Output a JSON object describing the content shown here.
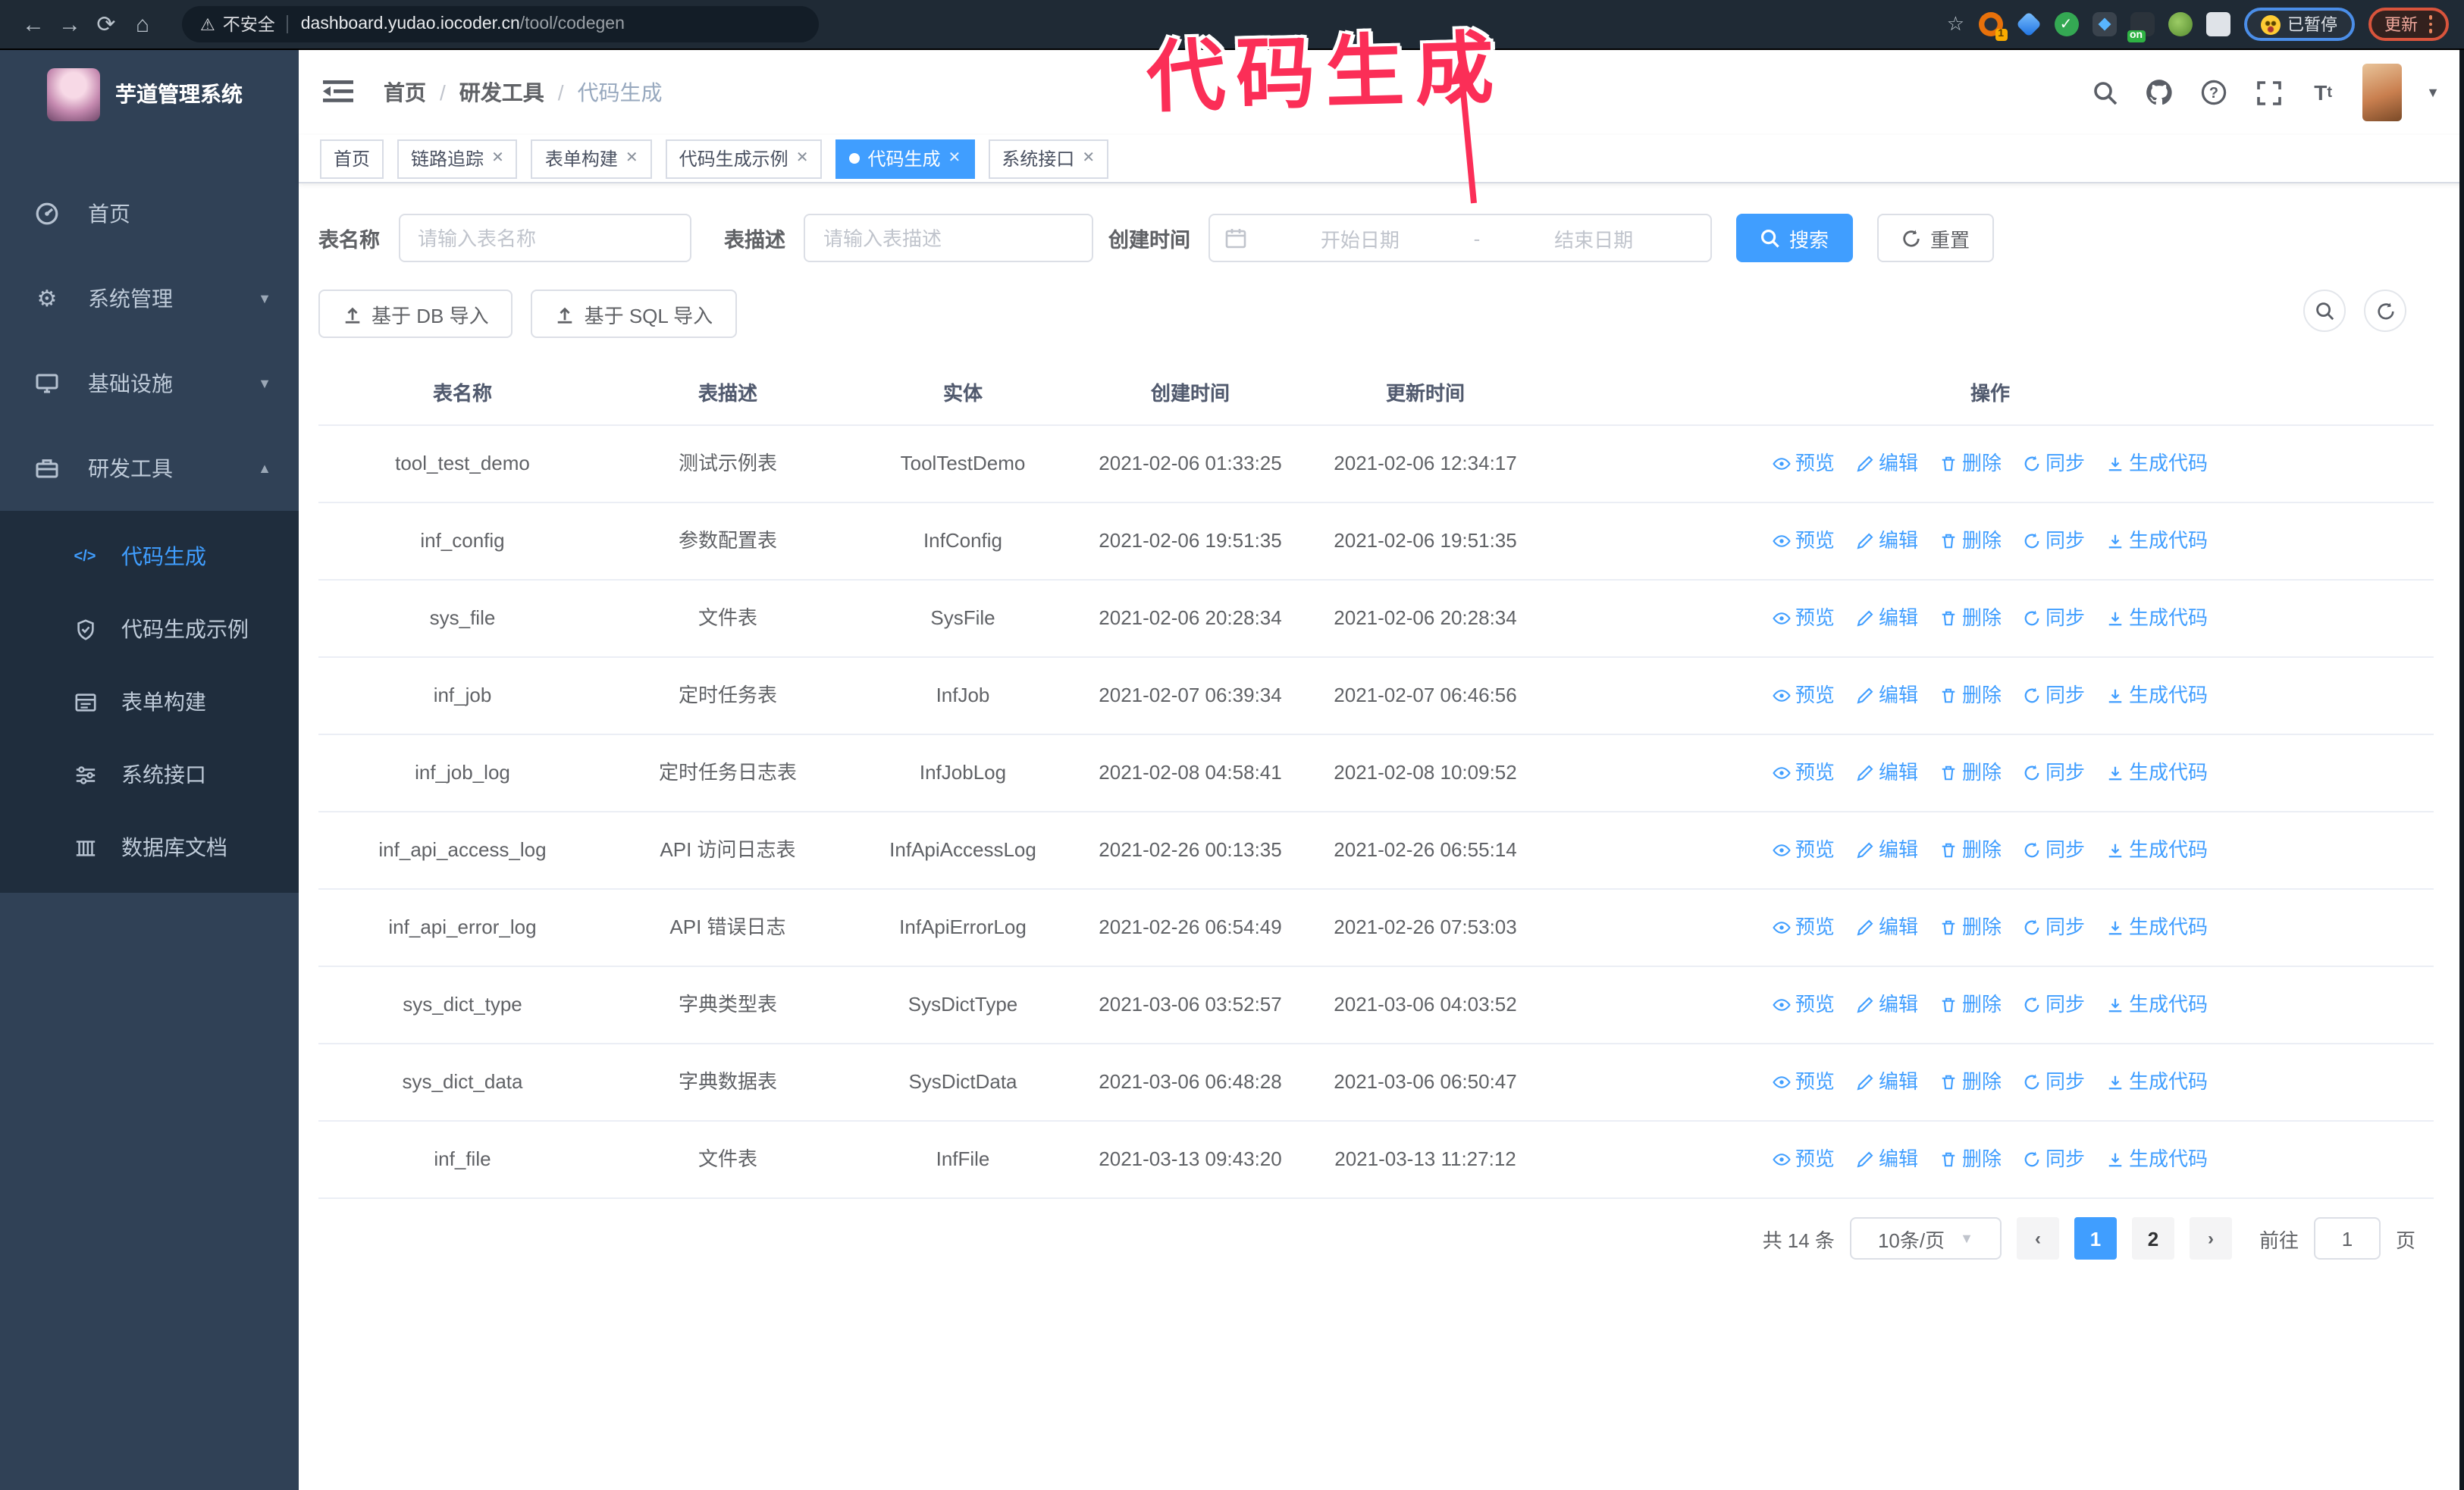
{
  "browser": {
    "security_label": "不安全",
    "url_host": "dashboard.yudao.iocoder.cn",
    "url_path": "/tool/codegen",
    "ext_badge_1": "1",
    "ext_badge_on": "on",
    "paused_badge": "已暂停",
    "update_badge": "更新"
  },
  "annotation": {
    "text": "代码生成",
    "color": "#fb2e57"
  },
  "sidebar": {
    "title": "芋道管理系统",
    "items": [
      {
        "label": "首页"
      },
      {
        "label": "系统管理"
      },
      {
        "label": "基础设施"
      },
      {
        "label": "研发工具"
      }
    ],
    "submenu": [
      {
        "label": "代码生成"
      },
      {
        "label": "代码生成示例"
      },
      {
        "label": "表单构建"
      },
      {
        "label": "系统接口"
      },
      {
        "label": "数据库文档"
      }
    ]
  },
  "breadcrumb": [
    "首页",
    "研发工具",
    "代码生成"
  ],
  "tabs": [
    {
      "label": "首页"
    },
    {
      "label": "链路追踪"
    },
    {
      "label": "表单构建"
    },
    {
      "label": "代码生成示例"
    },
    {
      "label": "代码生成"
    },
    {
      "label": "系统接口"
    }
  ],
  "filters": {
    "table_name_label": "表名称",
    "table_name_placeholder": "请输入表名称",
    "table_desc_label": "表描述",
    "table_desc_placeholder": "请输入表描述",
    "create_time_label": "创建时间",
    "date_start_placeholder": "开始日期",
    "date_separator": "-",
    "date_end_placeholder": "结束日期",
    "search_label": "搜索",
    "reset_label": "重置"
  },
  "toolbar": {
    "import_db_label": "基于 DB 导入",
    "import_sql_label": "基于 SQL 导入"
  },
  "table": {
    "columns": [
      "表名称",
      "表描述",
      "实体",
      "创建时间",
      "更新时间",
      "操作"
    ],
    "actions": [
      "预览",
      "编辑",
      "删除",
      "同步",
      "生成代码"
    ],
    "rows": [
      {
        "name": "tool_test_demo",
        "desc": "测试示例表",
        "entity": "ToolTestDemo",
        "created": "2021-02-06 01:33:25",
        "updated": "2021-02-06 12:34:17",
        "created_wrapped": false,
        "updated_wrapped": false
      },
      {
        "name": "inf_config",
        "desc": "参数配置表",
        "entity": "InfConfig",
        "created": "2021-02-06 19:51:35",
        "updated": "2021-02-06 19:51:35",
        "created_wrapped": false,
        "updated_wrapped": false
      },
      {
        "name": "sys_file",
        "desc": "文件表",
        "entity": "SysFile",
        "created": "2021-02-06 20:28:34",
        "updated": "2021-02-06 20:28:34",
        "created_wrapped": true,
        "updated_wrapped": true
      },
      {
        "name": "inf_job",
        "desc": "定时任务表",
        "entity": "InfJob",
        "created": "2021-02-07 06:39:34",
        "updated": "2021-02-07 06:46:56",
        "created_wrapped": true,
        "updated_wrapped": true
      },
      {
        "name": "inf_job_log",
        "desc": "定时任务日志表",
        "entity": "InfJobLog",
        "created": "2021-02-08 04:58:41",
        "updated": "2021-02-08 10:09:52",
        "created_wrapped": true,
        "updated_wrapped": true
      },
      {
        "name": "inf_api_access_log",
        "desc": "API 访问日志表",
        "entity": "InfApiAccessLog",
        "created": "2021-02-26 00:13:35",
        "updated": "2021-02-26 06:55:14",
        "created_wrapped": false,
        "updated_wrapped": true
      },
      {
        "name": "inf_api_error_log",
        "desc": "API 错误日志",
        "entity": "InfApiErrorLog",
        "created": "2021-02-26 06:54:49",
        "updated": "2021-02-26 07:53:03",
        "created_wrapped": true,
        "updated_wrapped": true
      },
      {
        "name": "sys_dict_type",
        "desc": "字典类型表",
        "entity": "SysDictType",
        "created": "2021-03-06 03:52:57",
        "updated": "2021-03-06 04:03:52",
        "created_wrapped": true,
        "updated_wrapped": true
      },
      {
        "name": "sys_dict_data",
        "desc": "字典数据表",
        "entity": "SysDictData",
        "created": "2021-03-06 06:48:28",
        "updated": "2021-03-06 06:50:47",
        "created_wrapped": true,
        "updated_wrapped": true
      },
      {
        "name": "inf_file",
        "desc": "文件表",
        "entity": "InfFile",
        "created": "2021-03-13 09:43:20",
        "updated": "2021-03-13 11:27:12",
        "created_wrapped": true,
        "updated_wrapped": false
      }
    ]
  },
  "pagination": {
    "total_label": "共 14 条",
    "page_size": "10条/页",
    "pages": [
      "1",
      "2"
    ],
    "active_page": "1",
    "goto_label": "前往",
    "goto_value": "1",
    "page_label": "页"
  },
  "colors": {
    "accent": "#409eff",
    "sidebar_bg": "#304156",
    "submenu_bg": "#1f2d3d",
    "chrome_bg": "#1f2a35",
    "annotation": "#fb2e57",
    "tag_active": "#409eff",
    "update_badge_border": "#d9543c",
    "paused_badge_border": "#4b8ee8"
  }
}
